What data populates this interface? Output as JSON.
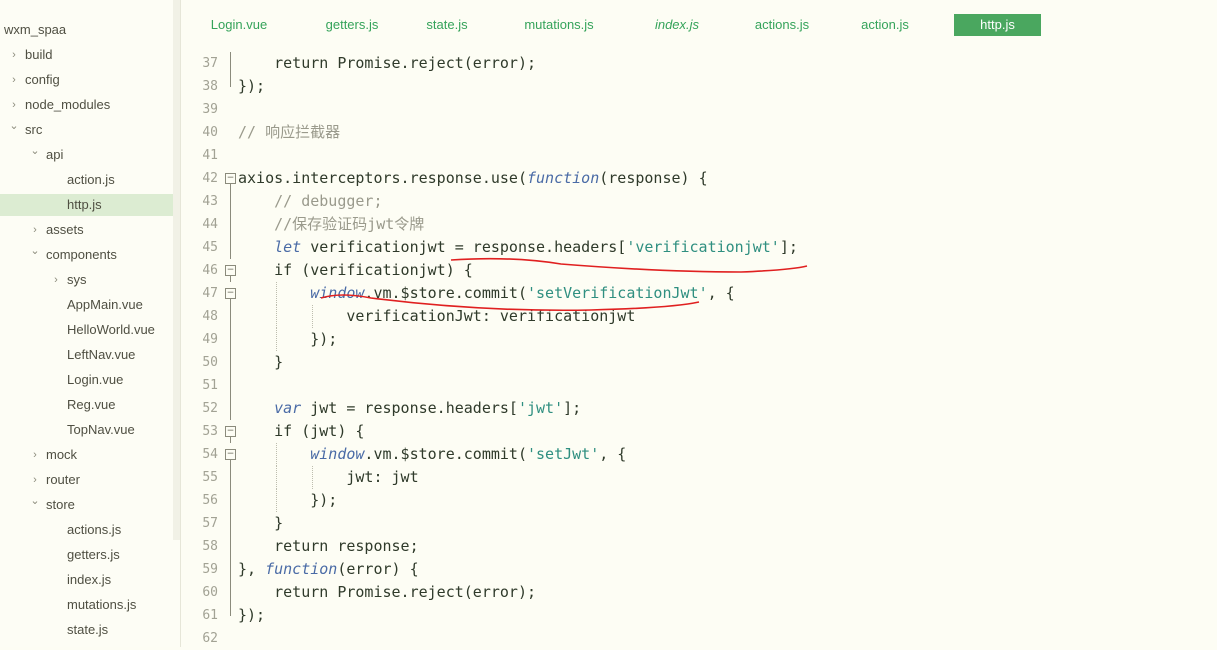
{
  "project": "wxm_spaa",
  "tree": [
    {
      "label": "wxm_spaa",
      "depth": 0,
      "arrow": ""
    },
    {
      "label": "build",
      "depth": 1,
      "arrow": "right"
    },
    {
      "label": "config",
      "depth": 1,
      "arrow": "right"
    },
    {
      "label": "node_modules",
      "depth": 1,
      "arrow": "right"
    },
    {
      "label": "src",
      "depth": 1,
      "arrow": "down"
    },
    {
      "label": "api",
      "depth": 2,
      "arrow": "down"
    },
    {
      "label": "action.js",
      "depth": 3,
      "arrow": ""
    },
    {
      "label": "http.js",
      "depth": 3,
      "arrow": "",
      "selected": true
    },
    {
      "label": "assets",
      "depth": 2,
      "arrow": "right"
    },
    {
      "label": "components",
      "depth": 2,
      "arrow": "down"
    },
    {
      "label": "sys",
      "depth": 3,
      "arrow": "right"
    },
    {
      "label": "AppMain.vue",
      "depth": 3,
      "arrow": ""
    },
    {
      "label": "HelloWorld.vue",
      "depth": 3,
      "arrow": ""
    },
    {
      "label": "LeftNav.vue",
      "depth": 3,
      "arrow": ""
    },
    {
      "label": "Login.vue",
      "depth": 3,
      "arrow": ""
    },
    {
      "label": "Reg.vue",
      "depth": 3,
      "arrow": ""
    },
    {
      "label": "TopNav.vue",
      "depth": 3,
      "arrow": ""
    },
    {
      "label": "mock",
      "depth": 2,
      "arrow": "right"
    },
    {
      "label": "router",
      "depth": 2,
      "arrow": "right"
    },
    {
      "label": "store",
      "depth": 2,
      "arrow": "down"
    },
    {
      "label": "actions.js",
      "depth": 3,
      "arrow": ""
    },
    {
      "label": "getters.js",
      "depth": 3,
      "arrow": ""
    },
    {
      "label": "index.js",
      "depth": 3,
      "arrow": ""
    },
    {
      "label": "mutations.js",
      "depth": 3,
      "arrow": ""
    },
    {
      "label": "state.js",
      "depth": 3,
      "arrow": ""
    }
  ],
  "tabs": [
    {
      "label": "Login.vue"
    },
    {
      "label": "getters.js"
    },
    {
      "label": "state.js"
    },
    {
      "label": "mutations.js"
    },
    {
      "label": "index.js",
      "italic": true
    },
    {
      "label": "actions.js"
    },
    {
      "label": "action.js"
    },
    {
      "label": "http.js",
      "active": true
    }
  ],
  "code_lines": [
    {
      "n": "37",
      "indent": 1,
      "segs": [
        [
          "t",
          "return Promise.reject(error);"
        ]
      ]
    },
    {
      "n": "38",
      "indent": 0,
      "segs": [
        [
          "t",
          "});"
        ]
      ]
    },
    {
      "n": "39",
      "indent": 0,
      "segs": []
    },
    {
      "n": "40",
      "indent": 0,
      "segs": [
        [
          "c",
          "// 响应拦截器"
        ]
      ]
    },
    {
      "n": "41",
      "indent": 0,
      "segs": []
    },
    {
      "n": "42",
      "indent": 0,
      "fold": true,
      "segs": [
        [
          "t",
          "axios.interceptors.response.use("
        ],
        [
          "k",
          "function"
        ],
        [
          "t",
          "(response) {"
        ]
      ]
    },
    {
      "n": "43",
      "indent": 1,
      "segs": [
        [
          "c",
          "// debugger;"
        ]
      ]
    },
    {
      "n": "44",
      "indent": 1,
      "segs": [
        [
          "c",
          "//保存验证码jwt令牌"
        ]
      ]
    },
    {
      "n": "45",
      "indent": 1,
      "segs": [
        [
          "k",
          "let"
        ],
        [
          "t",
          " verificationjwt = response.headers["
        ],
        [
          "s",
          "'verificationjwt'"
        ],
        [
          "t",
          "];"
        ]
      ]
    },
    {
      "n": "46",
      "indent": 1,
      "fold": true,
      "segs": [
        [
          "t",
          "if (verificationjwt) {"
        ]
      ]
    },
    {
      "n": "47",
      "indent": 2,
      "fold": true,
      "segs": [
        [
          "k",
          "window"
        ],
        [
          "t",
          ".vm.$store.commit("
        ],
        [
          "s",
          "'setVerificationJwt'"
        ],
        [
          "t",
          ", {"
        ]
      ]
    },
    {
      "n": "48",
      "indent": 3,
      "segs": [
        [
          "t",
          "verificationJwt: verificationjwt"
        ]
      ]
    },
    {
      "n": "49",
      "indent": 2,
      "segs": [
        [
          "t",
          "});"
        ]
      ]
    },
    {
      "n": "50",
      "indent": 1,
      "segs": [
        [
          "t",
          "}"
        ]
      ]
    },
    {
      "n": "51",
      "indent": 0,
      "segs": []
    },
    {
      "n": "52",
      "indent": 1,
      "segs": [
        [
          "k",
          "var"
        ],
        [
          "t",
          " jwt = response.headers["
        ],
        [
          "s",
          "'jwt'"
        ],
        [
          "t",
          "];"
        ]
      ]
    },
    {
      "n": "53",
      "indent": 1,
      "fold": true,
      "segs": [
        [
          "t",
          "if (jwt) {"
        ]
      ]
    },
    {
      "n": "54",
      "indent": 2,
      "fold": true,
      "segs": [
        [
          "k",
          "window"
        ],
        [
          "t",
          ".vm.$store.commit("
        ],
        [
          "s",
          "'setJwt'"
        ],
        [
          "t",
          ", {"
        ]
      ]
    },
    {
      "n": "55",
      "indent": 3,
      "segs": [
        [
          "t",
          "jwt: jwt"
        ]
      ]
    },
    {
      "n": "56",
      "indent": 2,
      "segs": [
        [
          "t",
          "});"
        ]
      ]
    },
    {
      "n": "57",
      "indent": 1,
      "segs": [
        [
          "t",
          "}"
        ]
      ]
    },
    {
      "n": "58",
      "indent": 1,
      "segs": [
        [
          "t",
          "return response;"
        ]
      ]
    },
    {
      "n": "59",
      "indent": 0,
      "segs": [
        [
          "t",
          "}, "
        ],
        [
          "k",
          "function"
        ],
        [
          "t",
          "(error) {"
        ]
      ]
    },
    {
      "n": "60",
      "indent": 1,
      "segs": [
        [
          "t",
          "return Promise.reject(error);"
        ]
      ]
    },
    {
      "n": "61",
      "indent": 0,
      "segs": [
        [
          "t",
          "});"
        ]
      ]
    },
    {
      "n": "62",
      "indent": 0,
      "segs": []
    }
  ],
  "colors": {
    "tab_text": "#35a35a",
    "tab_active_bg": "#4aa75f",
    "keyword": "#4a6ba6",
    "string": "#2f8f80",
    "comment": "#9a9a8c",
    "annotation": "#e02020"
  }
}
